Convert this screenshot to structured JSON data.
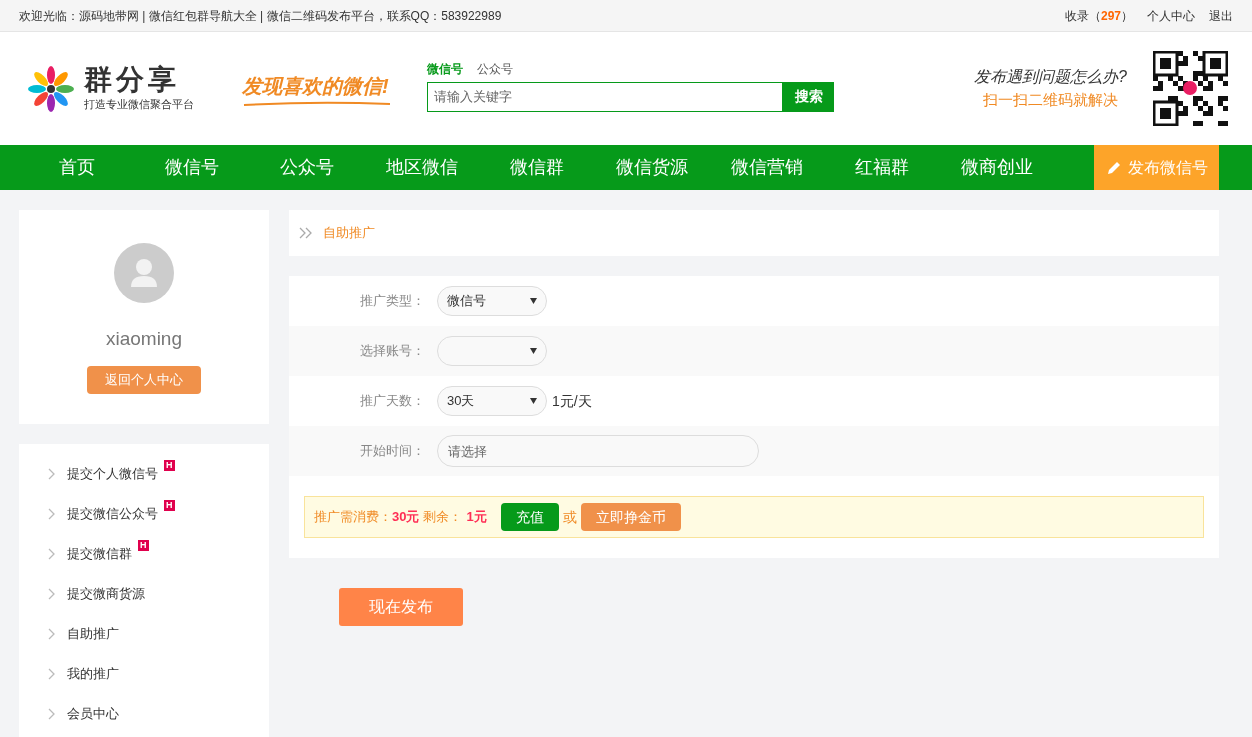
{
  "top_bar": {
    "welcome": "欢迎光临：源码地带网 | 微信红包群导航大全 | 微信二维码发布平台，联系QQ：583922989",
    "collect_label": "收录（",
    "collect_count": "297",
    "collect_close": "）",
    "links": [
      "个人中心",
      "退出"
    ]
  },
  "header": {
    "logo_title": "群分享",
    "logo_subtitle": "打造专业微信聚合平台",
    "slogan": "发现喜欢的微信!",
    "search_tabs": [
      {
        "label": "微信号",
        "selected": true
      },
      {
        "label": "公众号",
        "selected": false
      }
    ],
    "search": {
      "placeholder": "请输入关键字",
      "button": "搜索"
    },
    "help_question": "发布遇到问题怎么办?",
    "help_answer": "扫一扫二维码就解决"
  },
  "nav": {
    "items": [
      "首页",
      "微信号",
      "公众号",
      "地区微信",
      "微信群",
      "微信货源",
      "微信营销",
      "红福群",
      "微商创业"
    ],
    "publish_button": "发布微信号"
  },
  "profile": {
    "username": "xiaoming",
    "back_button": "返回个人中心"
  },
  "sidebar": {
    "items": [
      {
        "label": "提交个人微信号",
        "badge": "H"
      },
      {
        "label": "提交微信公众号",
        "badge": "H"
      },
      {
        "label": "提交微信群",
        "badge": "H"
      },
      {
        "label": "提交微商货源"
      },
      {
        "label": "自助推广"
      },
      {
        "label": "我的推广"
      },
      {
        "label": "会员中心"
      }
    ]
  },
  "breadcrumb": "自助推广",
  "form": {
    "fields": [
      {
        "kind": "select",
        "label": "推广类型：",
        "value": "微信号"
      },
      {
        "kind": "select",
        "label": "选择账号："
      },
      {
        "kind": "select",
        "label": "推广天数：",
        "value": "30天",
        "note": "1元/天"
      },
      {
        "kind": "input",
        "label": "开始时间：",
        "placeholder": "请选择"
      }
    ],
    "cost": {
      "cost_label": "推广需消费：",
      "cost_value": "30元",
      "remain_label": "剩余：",
      "remain_value": "1元",
      "recharge_button": "充值",
      "or": "或",
      "earn_button": "立即挣金币"
    },
    "submit_button": "现在发布"
  }
}
